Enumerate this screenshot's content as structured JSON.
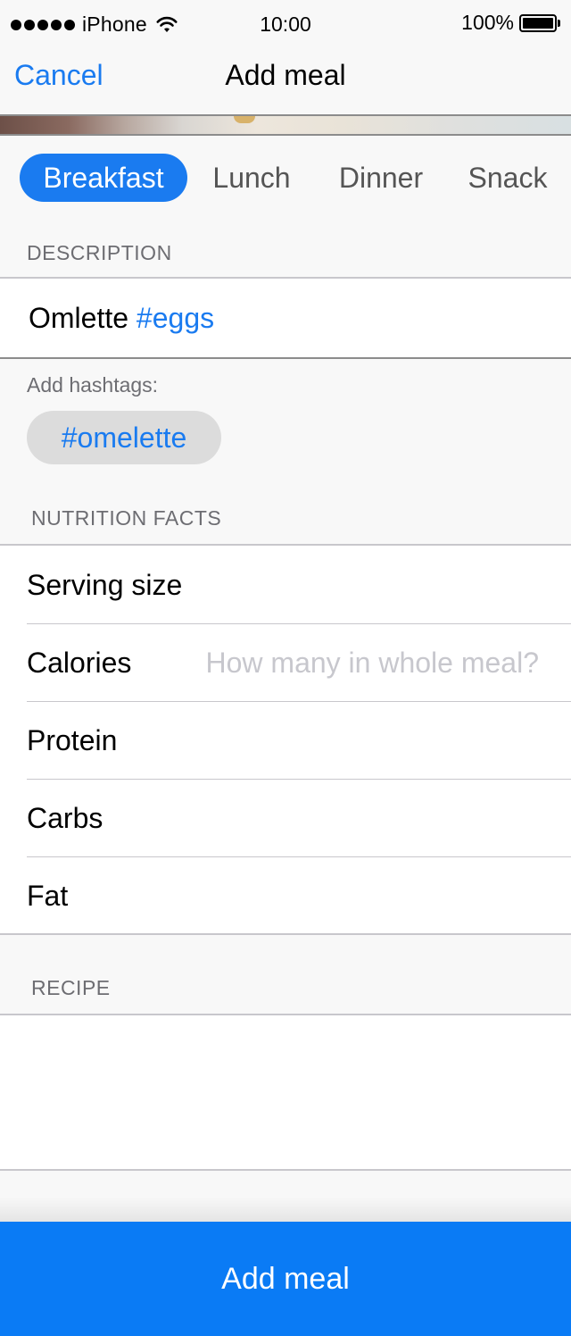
{
  "status_bar": {
    "carrier": "iPhone",
    "time": "10:00",
    "battery": "100%",
    "signal_icon": "signal-dots-icon",
    "wifi_icon": "wifi-icon",
    "battery_icon": "battery-icon"
  },
  "nav": {
    "cancel_label": "Cancel",
    "title": "Add meal"
  },
  "meal_types": {
    "items": [
      "Breakfast",
      "Lunch",
      "Dinner",
      "Snack"
    ],
    "selected": "Breakfast"
  },
  "description": {
    "header": "DESCRIPTION",
    "text": "Omlette ",
    "hashtag": "#eggs"
  },
  "hashtags": {
    "label": "Add hashtags:",
    "suggestions": [
      "#omelette"
    ]
  },
  "nutrition": {
    "header": "NUTRITION FACTS",
    "rows": [
      {
        "label": "Serving size",
        "value": "",
        "placeholder": ""
      },
      {
        "label": "Calories",
        "value": "",
        "placeholder": "How many in whole meal?"
      },
      {
        "label": "Protein",
        "value": "",
        "placeholder": ""
      },
      {
        "label": "Carbs",
        "value": "",
        "placeholder": ""
      },
      {
        "label": "Fat",
        "value": "",
        "placeholder": ""
      }
    ]
  },
  "recipe": {
    "header": "RECIPE",
    "value": ""
  },
  "footer": {
    "add_button_label": "Add meal"
  },
  "colors": {
    "accent": "#1a7bf0",
    "button": "#0a7bf5",
    "section_text": "#6d6d72",
    "background": "#f8f8f8"
  }
}
